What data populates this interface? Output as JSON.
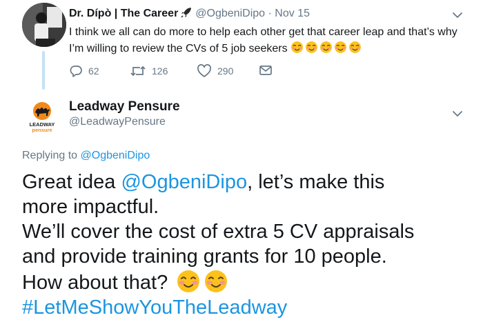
{
  "tweet1": {
    "name": "Dr. Dípò | The Career",
    "handle": "@OgbeniDipo",
    "separator": "·",
    "date": "Nov 15",
    "text": "I think we all can do more to help each other get that career leap and that’s why I’m willing to review the CVs of 5 job seekers",
    "emoji_count": 5,
    "replies": "62",
    "retweets": "126",
    "likes": "290"
  },
  "tweet2": {
    "name": "Leadway Pensure",
    "handle": "@LeadwayPensure",
    "logo_text_top": "LEADWAY",
    "logo_text_bottom": "pensure",
    "replying_prefix": "Replying to",
    "replying_handle": "@OgbeniDipo",
    "line1_prefix": "Great idea",
    "line1_mention": "@OgbeniDipo",
    "line1_suffix": ", let’s make this",
    "line2": "more impactful.",
    "line3": "We’ll cover the cost of extra 5 CV appraisals",
    "line4": "and provide training grants for 10 people.",
    "line5": "How about that?",
    "hashtag": "#LetMeShowYouTheLeadway"
  },
  "colors": {
    "link": "#1b95e0",
    "secondary": "#657786",
    "primary": "#14171a",
    "thread_line": "#c4e1f6",
    "logo_orange": "#f0891b"
  },
  "icons": [
    "rocket-icon",
    "reply-icon",
    "retweet-icon",
    "like-icon",
    "message-icon",
    "chevron-down-icon",
    "smiling-face-emoji"
  ]
}
